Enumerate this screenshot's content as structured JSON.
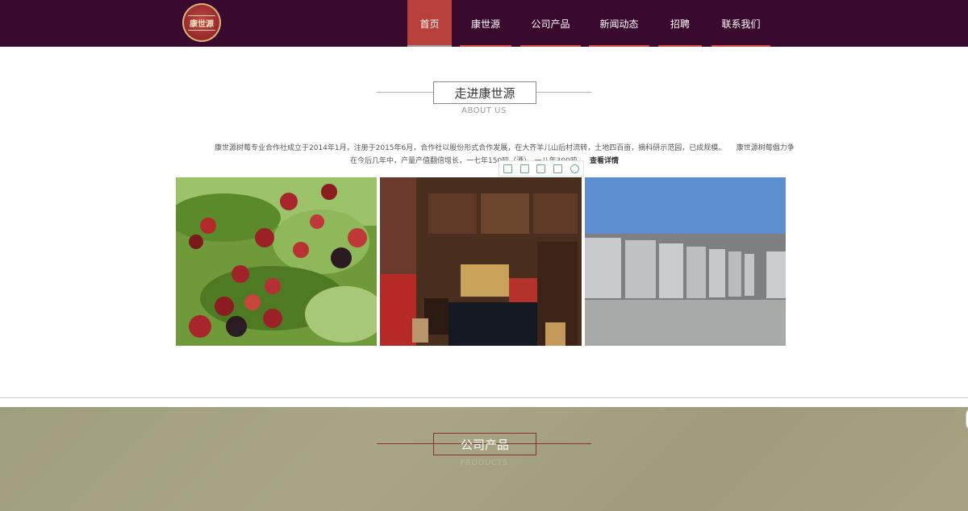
{
  "header": {
    "logo_text": "康世源",
    "nav": [
      "首页",
      "康世源",
      "公司产品",
      "新闻动态",
      "招聘",
      "联系我们"
    ]
  },
  "about": {
    "title": "走进康世源",
    "subtitle": "ABOUT US",
    "line1": "康世源树莓专业合作社成立于2014年1月，注册于2015年6月，合作社以股份形式合作发展，在大齐羊儿山后村流转，土地四百亩，摘科研示范园，已成规模。　　康世源树莓倡力争",
    "line2": "在今后几年中，产量产值翻倍增长，一七年150吨（酒），一八年300吨",
    "more": "查看详情"
  },
  "products": {
    "title": "公司产品",
    "subtitle": "PRODUCTS"
  },
  "colors": {
    "header_bg": "#3a0a2e",
    "nav_active": "#b8403a",
    "accent": "#d74a44",
    "products_bg": "#a4a283"
  },
  "icons": [
    "bookmark-icon",
    "fullscreen-icon",
    "save-icon",
    "share-icon",
    "settings-icon"
  ]
}
